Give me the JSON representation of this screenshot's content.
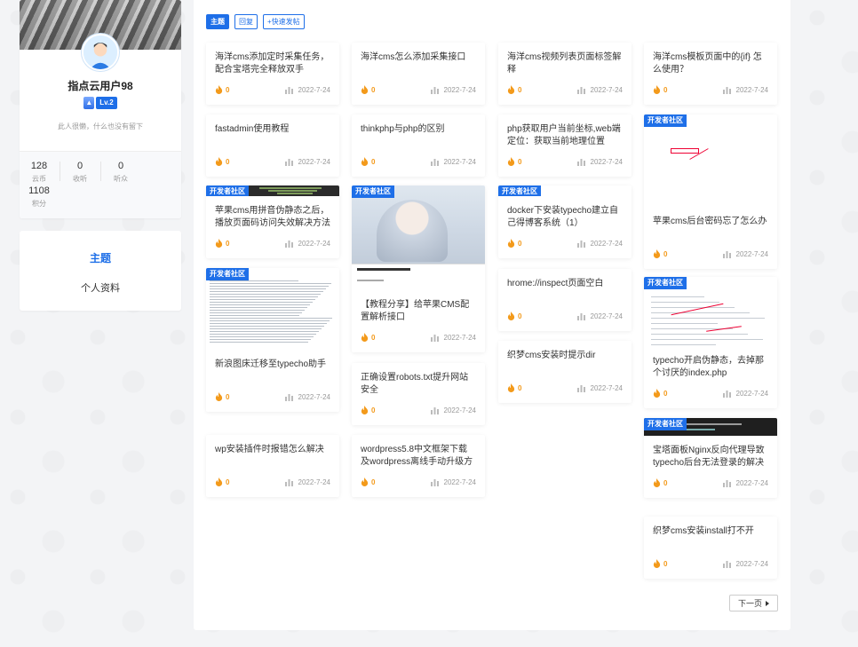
{
  "profile": {
    "username": "指点云用户98",
    "level": "Lv.2",
    "signature": "此人很懒，什么也没有留下",
    "stats": [
      {
        "value": "128",
        "label": "云币"
      },
      {
        "value": "0",
        "label": "收听"
      },
      {
        "value": "0",
        "label": "听众"
      },
      {
        "value": "1108",
        "label": "积分"
      }
    ]
  },
  "nav": {
    "active": "主题",
    "item": "个人资料"
  },
  "filters": [
    "主题",
    "回复",
    "+快速发帖"
  ],
  "tag_label": "开发者社区",
  "cards": [
    {
      "title": "海洋cms添加定时采集任务，配合宝塔完全释放双手",
      "likes": "0",
      "date": "2022-7-24"
    },
    {
      "title": "fastadmin使用教程",
      "likes": "0",
      "date": "2022-7-24"
    },
    {
      "title": "苹果cms用拼音伪静态之后，播放页面码访问失效解决方法",
      "likes": "0",
      "date": "2022-7-24"
    },
    {
      "title": "新浪图床迁移至typecho助手",
      "likes": "0",
      "date": "2022-7-24"
    },
    {
      "title": "wp安装插件时报错怎么解决",
      "likes": "0",
      "date": "2022-7-24"
    },
    {
      "title": "海洋cms怎么添加采集接口",
      "likes": "0",
      "date": "2022-7-24"
    },
    {
      "title": "thinkphp与php的区别",
      "likes": "0",
      "date": "2022-7-24"
    },
    {
      "title": "【教程分享】给苹果CMS配置解析接口",
      "likes": "0",
      "date": "2022-7-24"
    },
    {
      "title": "正确设置robots.txt提升网站安全",
      "likes": "0",
      "date": "2022-7-24"
    },
    {
      "title": "wordpress5.8中文框架下载及wordpress离线手动升级方",
      "likes": "0",
      "date": "2022-7-24"
    },
    {
      "title": "海洋cms视频列表页面标签解释",
      "likes": "0",
      "date": "2022-7-24"
    },
    {
      "title": "php获取用户当前坐标,web端定位：获取当前地理位置",
      "likes": "0",
      "date": "2022-7-24"
    },
    {
      "title": "docker下安装typecho建立自己得博客系统（1）",
      "likes": "0",
      "date": "2022-7-24"
    },
    {
      "title": "hrome://inspect页面空白",
      "likes": "0",
      "date": "2022-7-24"
    },
    {
      "title": "织梦cms安装时提示dir",
      "likes": "0",
      "date": "2022-7-24"
    },
    {
      "title": "海洋cms模板页面中的{if} 怎么使用？",
      "likes": "0",
      "date": "2022-7-24"
    },
    {
      "title": "苹果cms后台密码忘了怎么办",
      "likes": "0",
      "date": "2022-7-24"
    },
    {
      "title": "typecho开启伪静态，去掉那个讨厌的index.php",
      "likes": "0",
      "date": "2022-7-24"
    },
    {
      "title": "宝塔面板Nginx反向代理导致typecho后台无法登录的解决",
      "likes": "0",
      "date": "2022-7-24"
    },
    {
      "title": "织梦cms安装install打不开",
      "likes": "0",
      "date": "2022-7-24"
    }
  ],
  "pagination": {
    "next": "下一页"
  }
}
